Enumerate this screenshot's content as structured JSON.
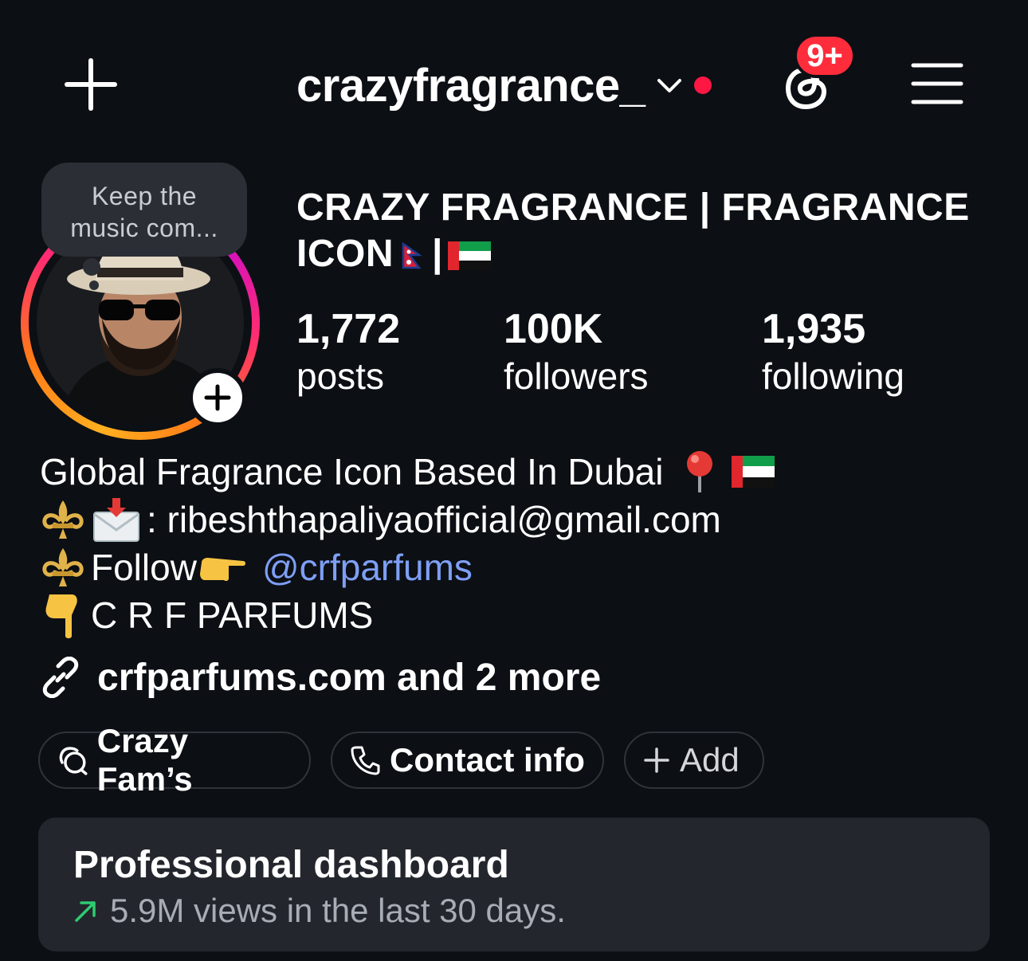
{
  "header": {
    "username": "crazyfragrance_",
    "notification_badge": "9+",
    "icons": {
      "create": "plus-icon",
      "switch_account": "chevron-down-icon",
      "threads": "threads-icon",
      "menu": "hamburger-menu-icon"
    },
    "accent_red": "#ff2d3b"
  },
  "profile": {
    "note": {
      "line1": "Keep the",
      "line2": "music com..."
    },
    "display_name_line1": "CRAZY FRAGRANCE | FRAGRANCE",
    "display_name_line2_text": "ICON",
    "display_name_separator": "|",
    "stats": {
      "posts": {
        "value": "1,772",
        "label": "posts"
      },
      "followers": {
        "value": "100K",
        "label": "followers"
      },
      "following": {
        "value": "1,935",
        "label": "following"
      }
    }
  },
  "bio": {
    "line1": "Global Fragrance Icon Based In Dubai",
    "line2": ": ribeshthapaliyaofficial@gmail.com",
    "line3_prefix": "Follow",
    "line3_mention": "@crfparfums",
    "line4": "C R F  PARFUMS",
    "link_text": "crfparfums.com and 2 more",
    "mention_color": "#7e9ff5"
  },
  "chips": {
    "fam": "Crazy Fam’s",
    "contact": "Contact info",
    "add": "Add"
  },
  "dashboard": {
    "title": "Professional dashboard",
    "subtitle": "5.9M views in the last 30 days.",
    "trend_color": "#2ecc71"
  }
}
